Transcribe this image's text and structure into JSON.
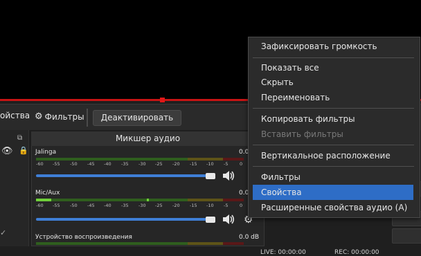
{
  "toolbar": {
    "properties_label": "ойства",
    "filters_label": "Фильтры",
    "deactivate_label": "Деактивировать"
  },
  "mixer": {
    "title": "Микшер аудио",
    "scale_ticks": [
      "-60",
      "-55",
      "-50",
      "-45",
      "-40",
      "-35",
      "-30",
      "-25",
      "-20",
      "-15",
      "-10",
      "-5",
      "0"
    ],
    "channels": [
      {
        "name": "Jalinga",
        "db": "0.0",
        "level": 0.0,
        "volume": 0.98
      },
      {
        "name": "Mic/Aux",
        "db": "0.0",
        "level": 0.05,
        "volume": 0.98
      },
      {
        "name": "Устройство воспроизведения",
        "db": "0.0 dB"
      }
    ]
  },
  "status": {
    "live": "LIVE: 00:00:00",
    "rec": "REC: 00:00:00"
  },
  "context_menu": {
    "lock_volume": "Зафиксировать громкость",
    "show_all": "Показать все",
    "hide": "Скрыть",
    "rename": "Переименовать",
    "copy_filters": "Копировать фильтры",
    "paste_filters": "Вставить фильтры",
    "vertical_layout": "Вертикальное расположение",
    "filters": "Фильтры",
    "properties": "Свойства",
    "advanced_audio": "Расширенные свойства аудио (A)",
    "highlighted": "Свойства"
  },
  "colors": {
    "accent": "#2e6dc6",
    "slider": "#3f7fd6",
    "red_line": "#c81414",
    "meter_green": "#4caf2a",
    "meter_yellow": "#b8a020",
    "meter_red": "#a02020"
  }
}
